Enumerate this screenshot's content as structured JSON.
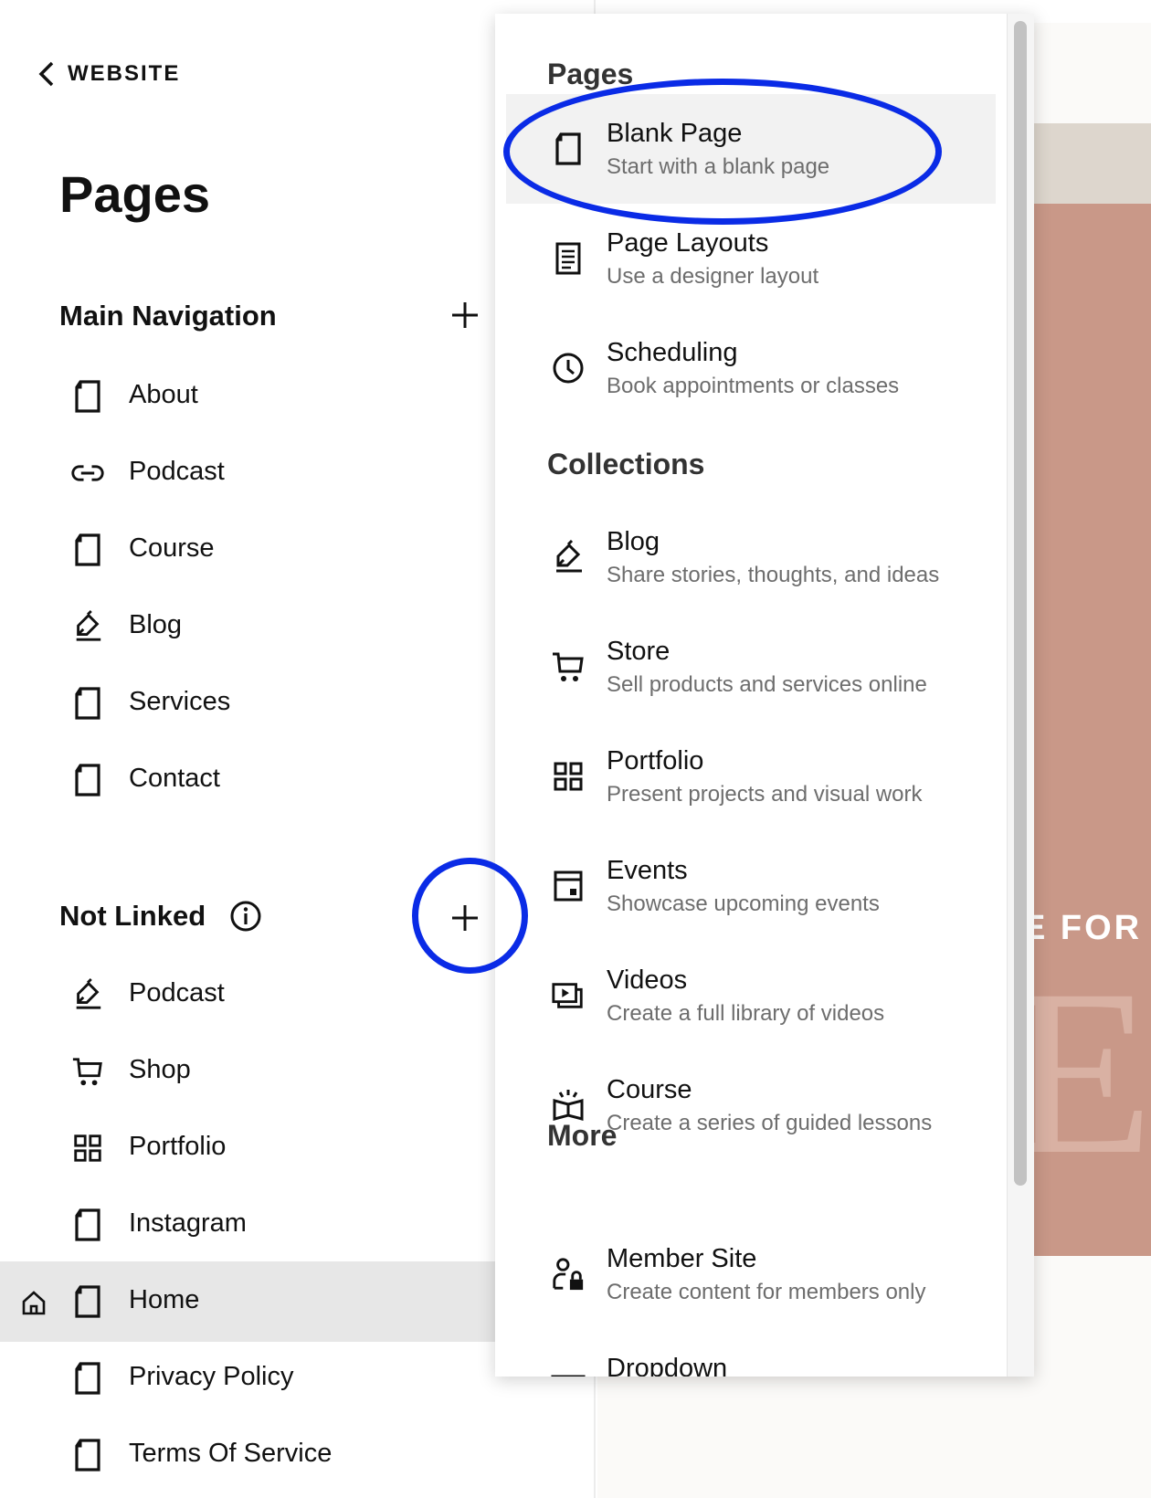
{
  "header": {
    "back_label": "WEBSITE",
    "title": "Pages"
  },
  "sidebar": {
    "main_nav_label": "Main Navigation",
    "main_nav_items": [
      {
        "label": "About",
        "icon": "page-icon"
      },
      {
        "label": "Podcast",
        "icon": "link-icon"
      },
      {
        "label": "Course",
        "icon": "page-icon"
      },
      {
        "label": "Blog",
        "icon": "blog-icon"
      },
      {
        "label": "Services",
        "icon": "page-icon"
      },
      {
        "label": "Contact",
        "icon": "page-icon"
      }
    ],
    "not_linked_label": "Not Linked",
    "not_linked_items": [
      {
        "label": "Podcast",
        "icon": "blog-icon"
      },
      {
        "label": "Shop",
        "icon": "cart-icon"
      },
      {
        "label": "Portfolio",
        "icon": "grid-icon"
      },
      {
        "label": "Instagram",
        "icon": "page-icon"
      },
      {
        "label": "Home",
        "icon": "page-icon",
        "homepage": true
      },
      {
        "label": "Privacy Policy",
        "icon": "page-icon"
      },
      {
        "label": "Terms Of Service",
        "icon": "page-icon"
      }
    ]
  },
  "menu": {
    "groups": [
      {
        "label": "Pages"
      },
      {
        "label": "Collections"
      },
      {
        "label": "More"
      }
    ],
    "items": [
      {
        "title": "Blank Page",
        "desc": "Start with a blank page",
        "icon": "page-icon"
      },
      {
        "title": "Page Layouts",
        "desc": "Use a designer layout",
        "icon": "layout-icon"
      },
      {
        "title": "Scheduling",
        "desc": "Book appointments or classes",
        "icon": "clock-icon"
      },
      {
        "title": "Blog",
        "desc": "Share stories, thoughts, and ideas",
        "icon": "blog-icon"
      },
      {
        "title": "Store",
        "desc": "Sell products and services online",
        "icon": "cart-icon"
      },
      {
        "title": "Portfolio",
        "desc": "Present projects and visual work",
        "icon": "grid-icon"
      },
      {
        "title": "Events",
        "desc": "Showcase upcoming events",
        "icon": "calendar-icon"
      },
      {
        "title": "Videos",
        "desc": "Create a full library of videos",
        "icon": "video-icon"
      },
      {
        "title": "Course",
        "desc": "Create a series of guided lessons",
        "icon": "course-icon"
      },
      {
        "title": "Member Site",
        "desc": "Create content for members only",
        "icon": "member-lock-icon"
      },
      {
        "title": "Dropdown",
        "desc": "",
        "icon": "dropdown-icon"
      }
    ]
  },
  "preview": {
    "promo_text": "E FOR",
    "big_letter": "E"
  },
  "colors": {
    "annotation": "#0a2be6",
    "hero_band": "#c99888"
  }
}
